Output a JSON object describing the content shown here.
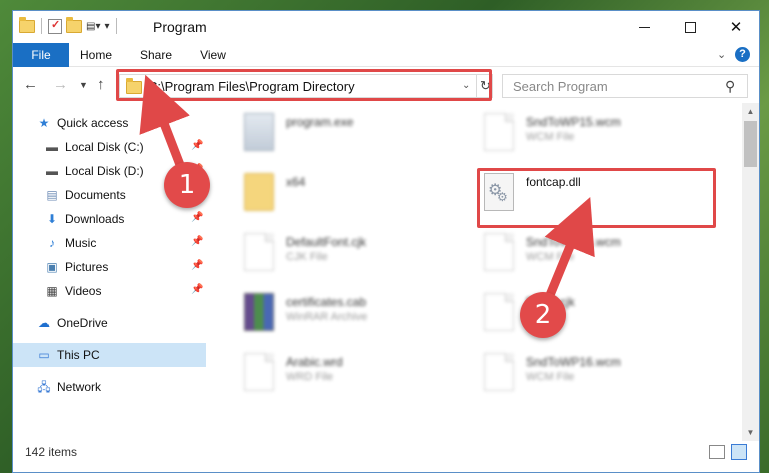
{
  "window": {
    "title": "Program",
    "controls": {
      "minimize": "—",
      "maximize": "",
      "close": "✕"
    }
  },
  "ribbon": {
    "tabs": [
      "File",
      "Home",
      "Share",
      "View"
    ],
    "help": "?"
  },
  "addressbar": {
    "path": "C:\\Program Files\\Program Directory",
    "search_placeholder": "Search Program"
  },
  "sidebar": {
    "items": [
      {
        "label": "Quick access",
        "icon": "star-icon",
        "pinned": false
      },
      {
        "label": "Local Disk (C:)",
        "icon": "drive-icon",
        "pinned": true
      },
      {
        "label": "Local Disk (D:)",
        "icon": "drive-icon",
        "pinned": true
      },
      {
        "label": "Documents",
        "icon": "documents-icon",
        "pinned": true
      },
      {
        "label": "Downloads",
        "icon": "downloads-icon",
        "pinned": true
      },
      {
        "label": "Music",
        "icon": "music-icon",
        "pinned": true
      },
      {
        "label": "Pictures",
        "icon": "pictures-icon",
        "pinned": true
      },
      {
        "label": "Videos",
        "icon": "videos-icon",
        "pinned": true
      },
      {
        "label": "OneDrive",
        "icon": "onedrive-icon",
        "pinned": false
      },
      {
        "label": "This PC",
        "icon": "pc-icon",
        "pinned": false,
        "selected": true
      },
      {
        "label": "Network",
        "icon": "network-icon",
        "pinned": false
      }
    ]
  },
  "files": [
    {
      "name": "program.exe",
      "type": "",
      "icon": "exe-icon"
    },
    {
      "name": "SndToWP15.wcm",
      "type": "WCM File",
      "icon": "file-icon"
    },
    {
      "name": "x64",
      "type": "",
      "icon": "folder-icon"
    },
    {
      "name": "fontcap.dll",
      "type": "",
      "icon": "dll-icon"
    },
    {
      "name": "DefaultFont.cjk",
      "type": "CJK File",
      "icon": "file-icon"
    },
    {
      "name": "SndToWP15.wcm",
      "type": "WCM File",
      "icon": "file-icon"
    },
    {
      "name": "certificates.cab",
      "type": "WinRAR Archive",
      "icon": "archive-icon"
    },
    {
      "name": "Bleed.cjk",
      "type": "",
      "icon": "file-icon"
    },
    {
      "name": "Arabic.wrd",
      "type": "WRD File",
      "icon": "file-icon"
    },
    {
      "name": "SndToWP16.wcm",
      "type": "WCM File",
      "icon": "file-icon"
    }
  ],
  "status": {
    "item_count": "142 items"
  },
  "annotations": {
    "badges": [
      "1",
      "2"
    ],
    "color": "#e04848"
  },
  "colors": {
    "accent": "#1a6fc4",
    "selection": "#cce4f7"
  }
}
